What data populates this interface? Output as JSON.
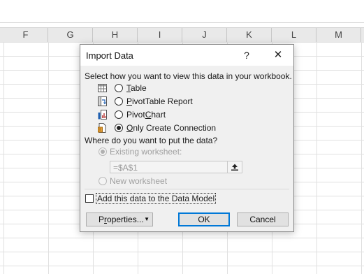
{
  "columns": [
    "F",
    "G",
    "H",
    "I",
    "J",
    "K",
    "L",
    "M"
  ],
  "dialog": {
    "title": "Import Data",
    "help_label": "?",
    "close_label": "✕",
    "select_view_prompt": "Select how you want to view this data in your workbook.",
    "view_options": [
      {
        "accel": "T",
        "rest": "able",
        "icon": "table-icon",
        "checked": false
      },
      {
        "accel": "P",
        "rest": "ivotTable Report",
        "icon": "pivottable-icon",
        "checked": false
      },
      {
        "pre": "Pivot",
        "accel": "C",
        "rest": "hart",
        "icon": "pivotchart-icon",
        "checked": false
      },
      {
        "accel": "O",
        "rest": "nly Create Connection",
        "icon": "connection-icon",
        "checked": true
      }
    ],
    "put_data_prompt": "Where do you want to put the data?",
    "existing_worksheet_label": "Existing worksheet:",
    "existing_worksheet_checked": true,
    "reference_value": "=$A$1",
    "reference_button_icon": "collapse-dialog-icon",
    "new_worksheet_label": "New worksheet",
    "data_model_label": "Add this data to the Data Model",
    "data_model_checked": false,
    "properties_accel": "r",
    "properties_pre": "P",
    "properties_rest": "operties...",
    "ok_label": "OK",
    "cancel_label": "Cancel"
  }
}
